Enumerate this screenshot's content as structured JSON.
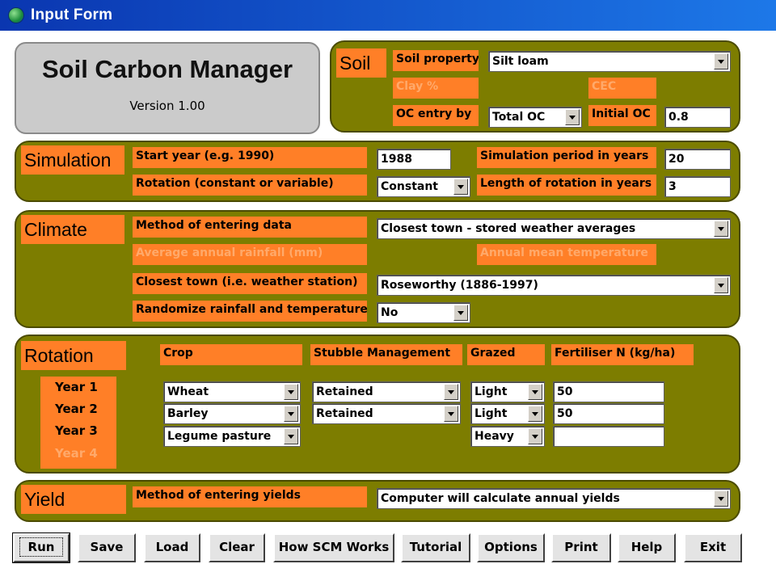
{
  "window": {
    "title": "Input Form",
    "icon": "globe-icon"
  },
  "header": {
    "app_name": "Soil Carbon Manager",
    "version": "Version 1.00"
  },
  "soil": {
    "section_label": "Soil",
    "soil_property_label": "Soil property",
    "soil_property_value": "Silt loam",
    "clay_label": "Clay %",
    "cec_label": "CEC",
    "oc_entry_label": "OC entry by",
    "oc_entry_value": "Total OC",
    "initial_oc_label": "Initial OC",
    "initial_oc_value": "0.8"
  },
  "simulation": {
    "section_label": "Simulation",
    "start_year_label": "Start year (e.g. 1990)",
    "start_year_value": "1988",
    "period_label": "Simulation period in years",
    "period_value": "20",
    "rotation_label": "Rotation (constant or variable)",
    "rotation_value": "Constant",
    "length_label": "Length of rotation in years",
    "length_value": "3"
  },
  "climate": {
    "section_label": "Climate",
    "method_label": "Method of entering data",
    "method_value": "Closest town - stored weather averages",
    "rainfall_label": "Average annual rainfall (mm)",
    "temperature_label": "Annual mean temperature",
    "town_label": "Closest town (i.e. weather station)",
    "town_value": "Roseworthy (1886-1997)",
    "randomize_label": "Randomize rainfall and temperature",
    "randomize_value": "No"
  },
  "rotation": {
    "section_label": "Rotation",
    "headers": {
      "crop": "Crop",
      "stubble": "Stubble Management",
      "grazed": "Grazed",
      "fertiliser": "Fertiliser N (kg/ha)"
    },
    "years": [
      {
        "label": "Year 1",
        "crop": "Wheat",
        "stubble": "Retained",
        "grazed": "Light",
        "fertiliser": "50"
      },
      {
        "label": "Year 2",
        "crop": "Barley",
        "stubble": "Retained",
        "grazed": "Light",
        "fertiliser": "50"
      },
      {
        "label": "Year 3",
        "crop": "Legume pasture",
        "stubble": "",
        "grazed": "Heavy",
        "fertiliser": ""
      },
      {
        "label": "Year 4"
      }
    ]
  },
  "yield": {
    "section_label": "Yield",
    "method_label": "Method of entering yields",
    "method_value": "Computer will calculate annual yields"
  },
  "buttons": {
    "run": "Run",
    "save": "Save",
    "load": "Load",
    "clear": "Clear",
    "how": "How SCM Works",
    "tutorial": "Tutorial",
    "options": "Options",
    "print": "Print",
    "help": "Help",
    "exit": "Exit"
  },
  "colors": {
    "panel": "#7d7d00",
    "label_bg": "#ff7f27",
    "disabled_text": "#ffa96a",
    "titlebar": "#0a36b0"
  }
}
